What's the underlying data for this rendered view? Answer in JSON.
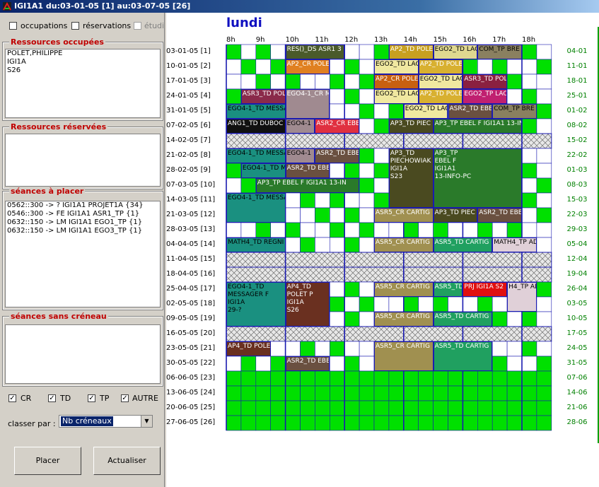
{
  "window": {
    "title": "IGI1A1 du:03-01-05 [1] au:03-07-05 [26]"
  },
  "filters": {
    "occupations": "occupations",
    "reservations": "réservations",
    "etudiants": "étudi"
  },
  "groups": {
    "occupied": {
      "title": "Ressources occupées",
      "items": [
        "POLET,PHILIPPE",
        "IGI1A",
        "S26"
      ]
    },
    "reserved": {
      "title": "Ressources réservées",
      "items": []
    },
    "to_place": {
      "title": "séances à placer",
      "items": [
        "0562::300 -> ? IGI1A1 PROJET1A {34}",
        "0546::300 -> FE IGI1A1 ASR1_TP {1}",
        "0632::150 -> LM IGI1A1 EGO1_TP {1}",
        "0632::150 -> LM IGI1A1 EGO3_TP {1}"
      ]
    },
    "no_slot": {
      "title": "séances sans créneau",
      "items": []
    }
  },
  "types": {
    "cr": "CR",
    "td": "TD",
    "tp": "TP",
    "autre": "AUTRE"
  },
  "sort": {
    "label": "classer par :",
    "value": "Nb créneaux"
  },
  "buttons": {
    "place": "Placer",
    "refresh": "Actualiser"
  },
  "planning": {
    "day": "lundi",
    "hours": [
      "8h",
      "9h",
      "10h",
      "11h",
      "12h",
      "13h",
      "14h",
      "15h",
      "16h",
      "17h",
      "18h"
    ],
    "weeks": [
      "03-01-05 [1]",
      "10-01-05 [2]",
      "17-01-05 [3]",
      "24-01-05 [4]",
      "31-01-05 [5]",
      "07-02-05 [6]",
      "14-02-05 [7]",
      "21-02-05 [8]",
      "28-02-05 [9]",
      "07-03-05 [10]",
      "14-03-05 [11]",
      "21-03-05 [12]",
      "28-03-05 [13]",
      "04-04-05 [14]",
      "11-04-05 [15]",
      "18-04-05 [16]",
      "25-04-05 [17]",
      "02-05-05 [18]",
      "09-05-05 [19]",
      "16-05-05 [20]",
      "23-05-05 [21]",
      "30-05-05 [22]",
      "06-06-05 [23]",
      "13-06-05 [24]",
      "20-06-05 [25]",
      "27-06-05 [26]"
    ],
    "right_dates": [
      "04-01",
      "11-01",
      "18-01",
      "25-01",
      "01-02",
      "08-02",
      "15-02",
      "22-02",
      "01-03",
      "08-03",
      "15-03",
      "22-03",
      "29-03",
      "05-04",
      "12-04",
      "19-04",
      "26-04",
      "03-05",
      "10-05",
      "17-05",
      "24-05",
      "31-05",
      "07-06",
      "14-06",
      "21-06",
      "28-06"
    ],
    "holiday_weeks": [
      7,
      15,
      16,
      20
    ],
    "events": [
      {
        "w": 1,
        "s": 4,
        "e": 8,
        "h": 1,
        "t": "RES()_DS ASR1 3",
        "c": "#4a5a2a",
        "f": "#fff"
      },
      {
        "w": 1,
        "s": 11,
        "e": 14,
        "h": 1,
        "t": "AP2_TD POLE",
        "c": "#c8a020",
        "f": "#fff"
      },
      {
        "w": 1,
        "s": 14,
        "e": 17,
        "h": 1,
        "t": "EGO2_TD LAC",
        "c": "#e0d890",
        "f": "#000"
      },
      {
        "w": 1,
        "s": 17,
        "e": 20,
        "h": 1,
        "t": "COM_TP BRE",
        "c": "#8a8060",
        "f": "#000"
      },
      {
        "w": 2,
        "s": 4,
        "e": 7,
        "h": 1,
        "t": "AP2_CR POLE",
        "c": "#e08020",
        "f": "#fff"
      },
      {
        "w": 2,
        "s": 10,
        "e": 13,
        "h": 1,
        "t": "EGO2_TD LAC",
        "c": "#f0e8a0",
        "f": "#000"
      },
      {
        "w": 2,
        "s": 13,
        "e": 16,
        "h": 1,
        "t": "AP2_TD POLE",
        "c": "#d8b030",
        "f": "#fff"
      },
      {
        "w": 3,
        "s": 10,
        "e": 13,
        "h": 1,
        "t": "AP2_CR POLE",
        "c": "#c86010",
        "f": "#fff"
      },
      {
        "w": 3,
        "s": 13,
        "e": 16,
        "h": 1,
        "t": "EGO2_TD LAC",
        "c": "#f0e8a0",
        "f": "#000"
      },
      {
        "w": 3,
        "s": 16,
        "e": 19,
        "h": 1,
        "t": "ASR3_TD POL",
        "c": "#8a2040",
        "f": "#fff"
      },
      {
        "w": 4,
        "s": 1,
        "e": 4,
        "h": 1,
        "t": "ASR3_TD POLE",
        "c": "#8a2a4a",
        "f": "#fff"
      },
      {
        "w": 4,
        "s": 4,
        "e": 7,
        "h": 2,
        "t": "EGO4-1_CR MESSA",
        "c": "#a08a90",
        "f": "#fff"
      },
      {
        "w": 4,
        "s": 10,
        "e": 13,
        "h": 1,
        "t": "EGO2_TD LAC",
        "c": "#f0e8a0",
        "f": "#000"
      },
      {
        "w": 4,
        "s": 13,
        "e": 16,
        "h": 1,
        "t": "AP2_TD POLE",
        "c": "#d8b030",
        "f": "#fff"
      },
      {
        "w": 4,
        "s": 16,
        "e": 19,
        "h": 1,
        "t": "EGO2_TP LAC",
        "c": "#c02070",
        "f": "#fff"
      },
      {
        "w": 5,
        "s": 0,
        "e": 4,
        "h": 1,
        "t": "EGO4-1_TD MESSA",
        "c": "#1a9080",
        "f": "#000"
      },
      {
        "w": 5,
        "s": 12,
        "e": 15,
        "h": 1,
        "t": "EGO2_TD LAC",
        "c": "#f0e8a0",
        "f": "#000"
      },
      {
        "w": 5,
        "s": 15,
        "e": 18,
        "h": 1,
        "t": "ASR2_TD EBE",
        "c": "#6a5040",
        "f": "#fff"
      },
      {
        "w": 5,
        "s": 18,
        "e": 21,
        "h": 1,
        "t": "COM_TP BRE",
        "c": "#8a8060",
        "f": "#000"
      },
      {
        "w": 6,
        "s": 0,
        "e": 4,
        "h": 1,
        "t": "ANG1_TD DUBOC",
        "c": "#101010",
        "f": "#fff"
      },
      {
        "w": 6,
        "s": 4,
        "e": 6,
        "h": 1,
        "t": "EGO4-1",
        "c": "#a08a90",
        "f": "#000"
      },
      {
        "w": 6,
        "s": 6,
        "e": 9,
        "h": 1,
        "t": "ASR2_CR EBE",
        "c": "#e03040",
        "f": "#fff"
      },
      {
        "w": 6,
        "s": 11,
        "e": 14,
        "h": 1,
        "t": "AP3_TD PIEC",
        "c": "#4a4a20",
        "f": "#fff"
      },
      {
        "w": 6,
        "s": 14,
        "e": 20,
        "h": 1,
        "t": "AP3_TP EBEL F IGI1A1 13-IN",
        "c": "#2a7a2a",
        "f": "#fff"
      },
      {
        "w": 8,
        "s": 0,
        "e": 4,
        "h": 1,
        "t": "EGO4-1_TD MESSA",
        "c": "#1a9080",
        "f": "#000"
      },
      {
        "w": 8,
        "s": 4,
        "e": 6,
        "h": 1,
        "t": "EGO4-1",
        "c": "#a08a90",
        "f": "#000"
      },
      {
        "w": 8,
        "s": 6,
        "e": 9,
        "h": 1,
        "t": "ASR2_TD EBE",
        "c": "#6a5040",
        "f": "#fff"
      },
      {
        "w": 8,
        "s": 11,
        "e": 14,
        "h": 4,
        "t": "AP3_TD|PIECHOWIAK|IGI1A|S23",
        "c": "#4a4a20",
        "f": "#fff"
      },
      {
        "w": 8,
        "s": 14,
        "e": 20,
        "h": 4,
        "t": "AP3_TP|EBEL F|IGI1A1|13-INFO-PC",
        "c": "#2a7a2a",
        "f": "#fff"
      },
      {
        "w": 9,
        "s": 1,
        "e": 4,
        "h": 1,
        "t": "EGO4-1_TD M",
        "c": "#1a9080",
        "f": "#000"
      },
      {
        "w": 9,
        "s": 4,
        "e": 7,
        "h": 1,
        "t": "ASR2_TD EBE",
        "c": "#6a5040",
        "f": "#fff"
      },
      {
        "w": 10,
        "s": 2,
        "e": 9,
        "h": 1,
        "t": "AP3_TP EBEL F IGI1A1 13-IN",
        "c": "#2a7a2a",
        "f": "#fff"
      },
      {
        "w": 11,
        "s": 0,
        "e": 4,
        "h": 2,
        "t": "EGO4-1_TD MESSA",
        "c": "#1a9080",
        "f": "#000"
      },
      {
        "w": 12,
        "s": 10,
        "e": 14,
        "h": 1,
        "t": "ASR5_CR CARTIG",
        "c": "#a09050",
        "f": "#fff"
      },
      {
        "w": 12,
        "s": 14,
        "e": 17,
        "h": 1,
        "t": "AP3_TD PIEC",
        "c": "#4a4a20",
        "f": "#fff"
      },
      {
        "w": 12,
        "s": 17,
        "e": 20,
        "h": 1,
        "t": "ASR2_TD EBE",
        "c": "#6a5040",
        "f": "#fff"
      },
      {
        "w": 14,
        "s": 0,
        "e": 4,
        "h": 1,
        "t": "MATH4_TD REGNI",
        "c": "#1a9080",
        "f": "#000"
      },
      {
        "w": 14,
        "s": 10,
        "e": 14,
        "h": 1,
        "t": "ASR5_CR CARTIG",
        "c": "#a09050",
        "f": "#fff"
      },
      {
        "w": 14,
        "s": 14,
        "e": 18,
        "h": 1,
        "t": "ASR5_TD CARTIG",
        "c": "#20a060",
        "f": "#fff"
      },
      {
        "w": 14,
        "s": 18,
        "e": 21,
        "h": 1,
        "t": "MATH4_TP AD",
        "c": "#e0d0d8",
        "f": "#000"
      },
      {
        "w": 17,
        "s": 0,
        "e": 4,
        "h": 3,
        "t": "EGO4-1_TD|MESSAGER F|IGI1A|29-?",
        "c": "#1a9080",
        "f": "#000"
      },
      {
        "w": 17,
        "s": 4,
        "e": 7,
        "h": 3,
        "t": "AP4_TD|POLET P|IGI1A|S26",
        "c": "#6a3020",
        "f": "#fff"
      },
      {
        "w": 17,
        "s": 10,
        "e": 14,
        "h": 1,
        "t": "ASR5_CR CARTIG",
        "c": "#a09050",
        "f": "#fff"
      },
      {
        "w": 17,
        "s": 14,
        "e": 16,
        "h": 1,
        "t": "ASR5_TD",
        "c": "#20a060",
        "f": "#fff"
      },
      {
        "w": 17,
        "s": 16,
        "e": 19,
        "h": 1,
        "t": "PRJ IGI1A S2",
        "c": "#e01010",
        "f": "#fff"
      },
      {
        "w": 17,
        "s": 19,
        "e": 21,
        "h": 2,
        "t": "H4_TP AD",
        "c": "#e0d0d8",
        "f": "#000"
      },
      {
        "w": 19,
        "s": 10,
        "e": 14,
        "h": 1,
        "t": "ASR5_CR CARTIG",
        "c": "#a09050",
        "f": "#fff"
      },
      {
        "w": 19,
        "s": 14,
        "e": 18,
        "h": 1,
        "t": "ASR5_TD CARTIG",
        "c": "#20a060",
        "f": "#fff"
      },
      {
        "w": 21,
        "s": 0,
        "e": 3,
        "h": 1,
        "t": "AP4_TD POLE",
        "c": "#6a3020",
        "f": "#fff"
      },
      {
        "w": 21,
        "s": 10,
        "e": 14,
        "h": 2,
        "t": "ASR5_CR CARTIG",
        "c": "#a09050",
        "f": "#fff"
      },
      {
        "w": 21,
        "s": 14,
        "e": 18,
        "h": 2,
        "t": "ASR5_TD CARTIG",
        "c": "#20a060",
        "f": "#fff"
      },
      {
        "w": 22,
        "s": 4,
        "e": 7,
        "h": 1,
        "t": "ASR2_TD EBE",
        "c": "#6a5040",
        "f": "#fff"
      }
    ]
  },
  "colors": {
    "free": "#00e000",
    "grid": "#1a1ab0",
    "holiday": "#d8d8d8",
    "green_text": "#008000",
    "red_title": "#c00000",
    "day": "#1010c0"
  }
}
